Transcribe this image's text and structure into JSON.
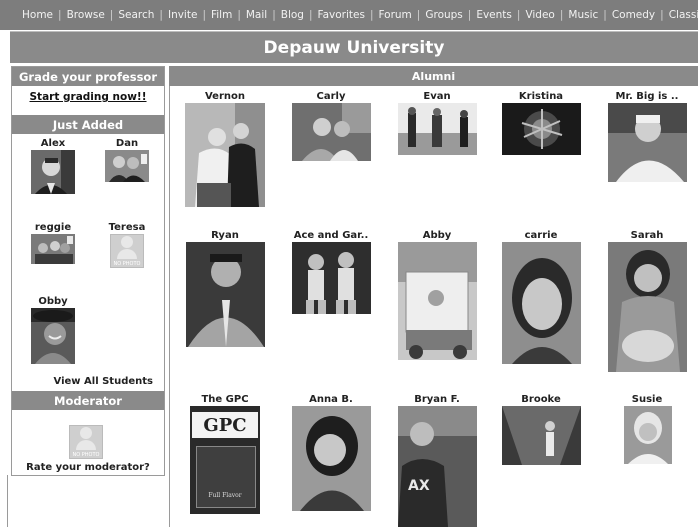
{
  "topnav": {
    "items": [
      "Home",
      "Browse",
      "Search",
      "Invite",
      "Film",
      "Mail",
      "Blog",
      "Favorites",
      "Forum",
      "Groups",
      "Events",
      "Video",
      "Music",
      "Comedy",
      "Classifieds"
    ]
  },
  "page": {
    "title": "Depauw University"
  },
  "sidebar": {
    "grade_heading": "Grade your professor",
    "grade_link": "Start grading now!!",
    "just_added_heading": "Just Added",
    "students": [
      {
        "name": "Alex"
      },
      {
        "name": "Dan"
      },
      {
        "name": "reggie"
      },
      {
        "name": "Teresa"
      },
      {
        "name": "Obby"
      }
    ],
    "no_photo_label": "NO PHOTO",
    "view_all": "View All Students",
    "moderator_heading": "Moderator",
    "rate_moderator": "Rate your moderator?"
  },
  "alumni": {
    "heading": "Alumni",
    "people": [
      {
        "name": "Vernon"
      },
      {
        "name": "Carly"
      },
      {
        "name": "Evan"
      },
      {
        "name": "Kristina"
      },
      {
        "name": "Mr. Big is .."
      },
      {
        "name": "Ryan"
      },
      {
        "name": "Ace and Gar.."
      },
      {
        "name": "Abby"
      },
      {
        "name": "carrie"
      },
      {
        "name": "Sarah"
      },
      {
        "name": "The GPC"
      },
      {
        "name": "Anna B."
      },
      {
        "name": "Bryan F."
      },
      {
        "name": "Brooke"
      },
      {
        "name": "Susie"
      }
    ],
    "gpc_logo_text": "GPC",
    "gpc_sub_text": "Full Flavor"
  }
}
